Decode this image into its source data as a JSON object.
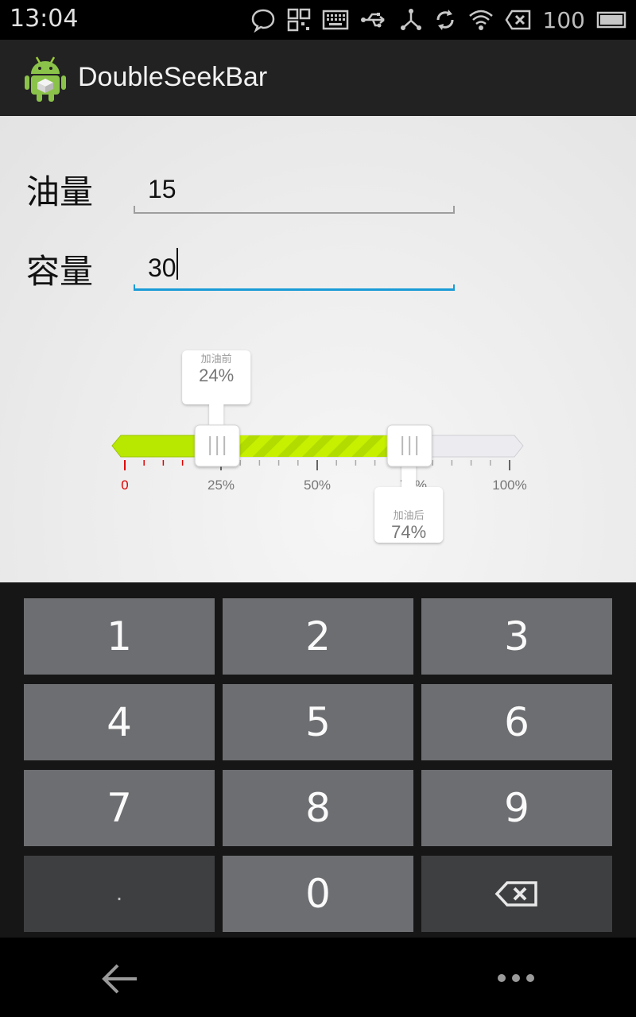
{
  "status_bar": {
    "time": "13:04",
    "battery_level": "100",
    "icons": [
      "chat-bubble-icon",
      "qr-code-icon",
      "keyboard-icon",
      "usb-icon",
      "share-network-icon",
      "sync-icon",
      "wifi-icon",
      "sim-off-icon",
      "battery-icon"
    ]
  },
  "action_bar": {
    "app_icon": "android-robot-icon",
    "title": "DoubleSeekBar"
  },
  "form": {
    "fuel_label": "油量",
    "fuel_value": "15",
    "capacity_label": "容量",
    "capacity_value": "30"
  },
  "seekbar": {
    "before_label": "加油前",
    "before_value": "24%",
    "before_fraction": 0.24,
    "after_label": "加油后",
    "after_value": "74%",
    "after_fraction": 0.74,
    "ticks": [
      "0",
      "25%",
      "50%",
      "75%",
      "100%"
    ],
    "colors": {
      "fill": "#b8e800",
      "track": "#e8e8ec",
      "zero_tick": "#e00000"
    }
  },
  "keyboard": {
    "rows": [
      [
        "1",
        "2",
        "3"
      ],
      [
        "4",
        "5",
        "6"
      ],
      [
        "7",
        "8",
        "9"
      ],
      [
        ".",
        "0",
        "backspace-icon"
      ]
    ]
  },
  "nav_bar": {
    "back_icon": "back-arrow-icon",
    "menu_icon": "overflow-menu-icon"
  }
}
